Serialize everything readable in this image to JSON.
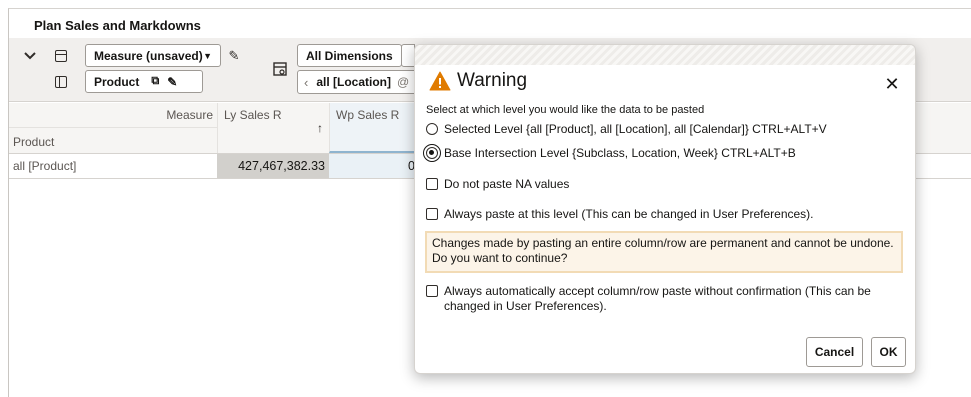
{
  "app": {
    "title": "Plan Sales and Markdowns",
    "toolbar": {
      "measure_dropdown": "Measure (unsaved)",
      "product_dropdown": "Product",
      "all_dimensions_label": "All Dimensions",
      "location_label": "all [Location]"
    },
    "grid": {
      "measure_header": "Measure",
      "product_header": "Product",
      "columns": [
        "Ly Sales R",
        "Wp Sales R"
      ],
      "rows": [
        {
          "label": "all [Product]",
          "values": [
            "427,467,382.33",
            "0"
          ]
        }
      ]
    }
  },
  "dialog": {
    "title": "Warning",
    "intro": "Select at which level you would like the data to be pasted",
    "options": [
      {
        "label": "Selected Level {all [Product], all [Location], all [Calendar]} CTRL+ALT+V",
        "selected": false
      },
      {
        "label": "Base Intersection Level {Subclass, Location, Week} CTRL+ALT+B",
        "selected": true
      }
    ],
    "checkboxes": {
      "no_na": "Do not paste NA values",
      "always_level": "Always paste at this level (This can be changed in User Preferences).",
      "auto_accept": "Always automatically accept column/row paste without confirmation (This can be changed in User Preferences)."
    },
    "warning_message": "Changes made by pasting an entire column/row are permanent and cannot be undone. Do you want to continue?",
    "buttons": {
      "cancel": "Cancel",
      "ok": "OK"
    }
  },
  "colors": {
    "warning_icon": "#e07b00",
    "warning_box_bg": "#fcf4e8",
    "warning_box_border": "#f2dbb5"
  }
}
